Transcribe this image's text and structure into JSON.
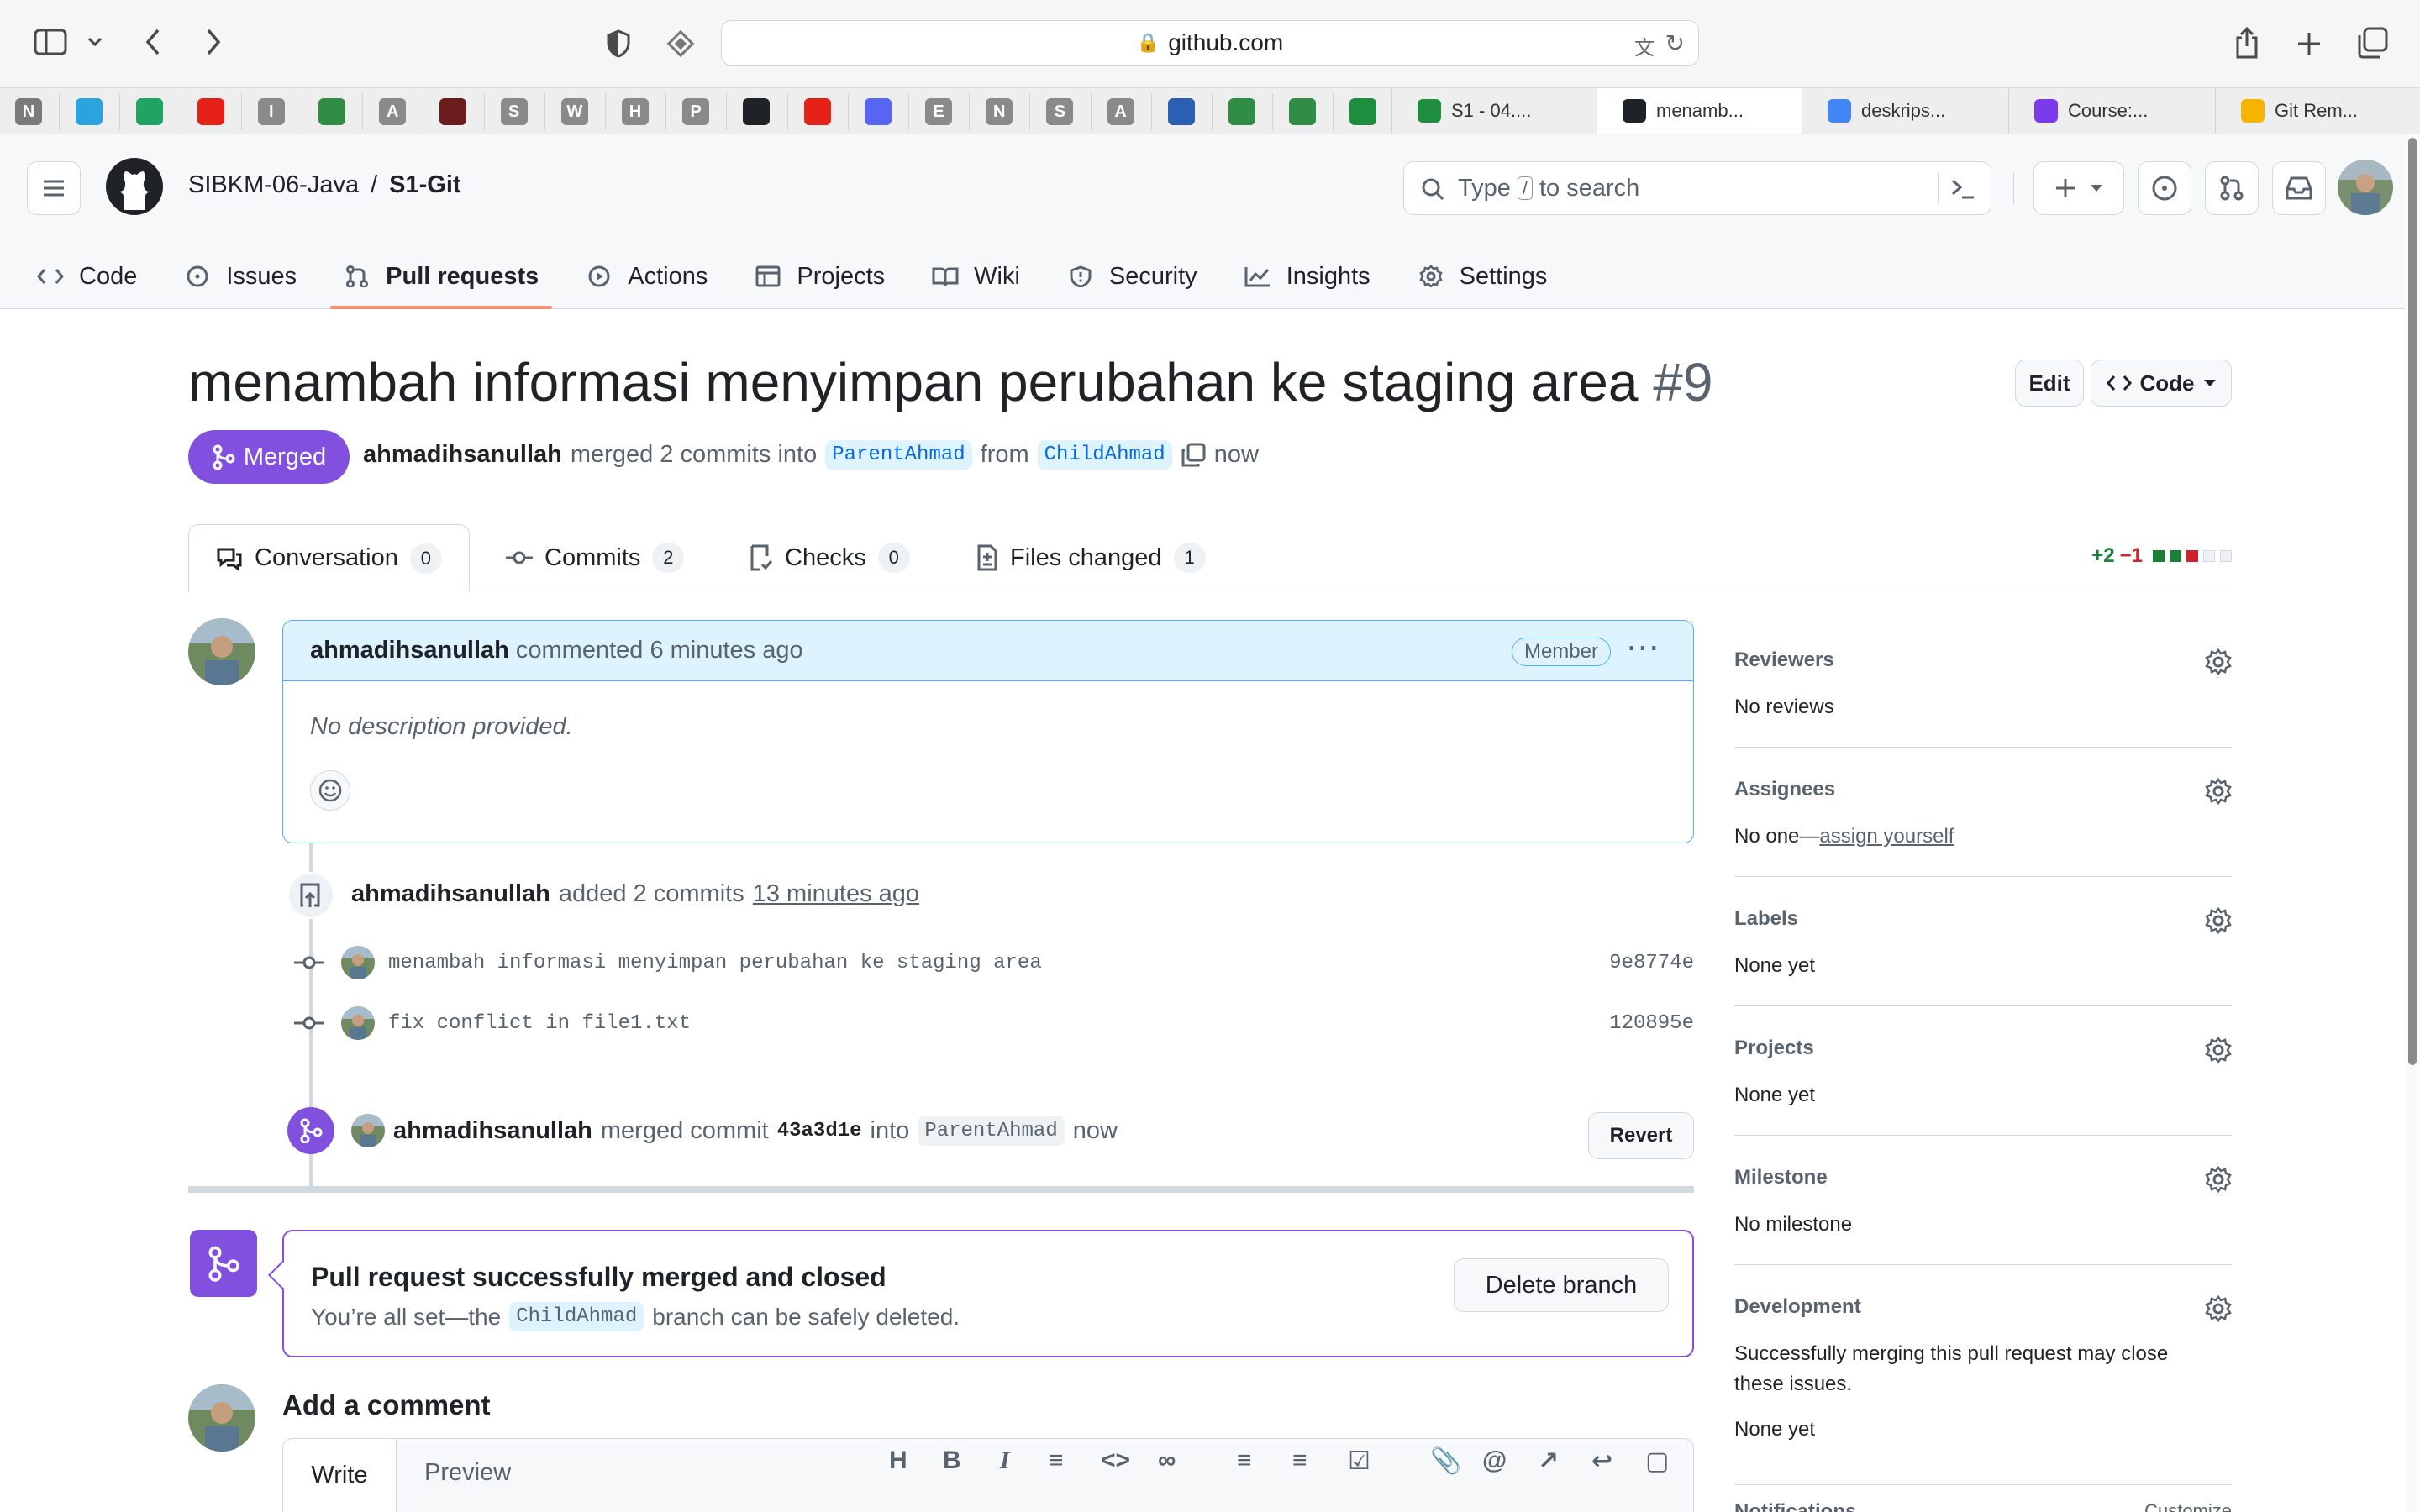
{
  "browser": {
    "address": "github.com",
    "pinned_tabs": [
      {
        "icon": "notion-icon",
        "letter": "N",
        "color": "#7a7a7a"
      },
      {
        "icon": "telegram-icon",
        "letter": "",
        "color": "#2aa3df"
      },
      {
        "icon": "google-drive-icon",
        "letter": "",
        "color": "#1fa463"
      },
      {
        "icon": "youtube-icon",
        "letter": "",
        "color": "#e62117"
      },
      {
        "icon": "site-i-icon",
        "letter": "I",
        "color": "#8a8a8a"
      },
      {
        "icon": "geeks-icon",
        "letter": "",
        "color": "#2f8d46"
      },
      {
        "icon": "site-a-icon",
        "letter": "A",
        "color": "#8a8a8a"
      },
      {
        "icon": "anime-icon",
        "letter": "",
        "color": "#6b1c1c"
      },
      {
        "icon": "site-s-icon",
        "letter": "S",
        "color": "#8a8a8a"
      },
      {
        "icon": "site-w-icon",
        "letter": "W",
        "color": "#8a8a8a"
      },
      {
        "icon": "site-h-icon",
        "letter": "H",
        "color": "#8a8a8a"
      },
      {
        "icon": "site-p-icon",
        "letter": "P",
        "color": "#8a8a8a"
      },
      {
        "icon": "github-icon",
        "letter": "",
        "color": "#1f2328"
      },
      {
        "icon": "youtube-icon",
        "letter": "",
        "color": "#e62117"
      },
      {
        "icon": "discord-icon",
        "letter": "",
        "color": "#5865f2"
      },
      {
        "icon": "site-e-icon",
        "letter": "E",
        "color": "#8a8a8a"
      },
      {
        "icon": "site-n-icon",
        "letter": "N",
        "color": "#8a8a8a"
      },
      {
        "icon": "site-s-icon",
        "letter": "S",
        "color": "#8a8a8a"
      },
      {
        "icon": "site-a-icon",
        "letter": "A",
        "color": "#8a8a8a"
      },
      {
        "icon": "kampus-icon",
        "letter": "",
        "color": "#2b5fb4"
      },
      {
        "icon": "geeks-icon",
        "letter": "",
        "color": "#2f8d46"
      },
      {
        "icon": "geeks-icon",
        "letter": "",
        "color": "#2f8d46"
      },
      {
        "icon": "classroom-icon",
        "letter": "",
        "color": "#1e8e3e"
      }
    ],
    "tabs": [
      {
        "label": "S1 - 04....",
        "icon": "classroom-icon",
        "color": "#1e8e3e"
      },
      {
        "label": "menamb...",
        "icon": "github-icon",
        "color": "#1f2328"
      },
      {
        "label": "deskrips...",
        "icon": "google-icon",
        "color": "#4285f4"
      },
      {
        "label": "Course:...",
        "icon": "course-icon",
        "color": "#7c3aed"
      },
      {
        "label": "Git Rem...",
        "icon": "slides-icon",
        "color": "#f4b400"
      }
    ]
  },
  "github": {
    "owner": "SIBKM-06-Java",
    "separator": "/",
    "repo": "S1-Git",
    "search_prefix": "Type",
    "search_key": "/",
    "search_suffix": "to search",
    "nav": [
      {
        "label": "Code",
        "icon": "code-icon"
      },
      {
        "label": "Issues",
        "icon": "issue-icon"
      },
      {
        "label": "Pull requests",
        "icon": "pull-request-icon"
      },
      {
        "label": "Actions",
        "icon": "play-icon"
      },
      {
        "label": "Projects",
        "icon": "table-icon"
      },
      {
        "label": "Wiki",
        "icon": "book-icon"
      },
      {
        "label": "Security",
        "icon": "shield-icon"
      },
      {
        "label": "Insights",
        "icon": "graph-icon"
      },
      {
        "label": "Settings",
        "icon": "gear-icon"
      }
    ]
  },
  "pr": {
    "title": "menambah informasi menyimpan perubahan ke staging area",
    "number": "#9",
    "edit_label": "Edit",
    "code_label": "Code",
    "state": "Merged",
    "author": "ahmadihsanullah",
    "merged_text": "merged 2 commits into",
    "base_branch": "ParentAhmad",
    "from_text": "from",
    "head_branch": "ChildAhmad",
    "time": "now",
    "tabs": [
      {
        "label": "Conversation",
        "count": "0",
        "icon": "comment-icon"
      },
      {
        "label": "Commits",
        "count": "2",
        "icon": "commit-icon"
      },
      {
        "label": "Checks",
        "count": "0",
        "icon": "checklist-icon"
      },
      {
        "label": "Files changed",
        "count": "1",
        "icon": "file-diff-icon"
      }
    ],
    "additions": "+2",
    "deletions": "−1"
  },
  "comment": {
    "author": "ahmadihsanullah",
    "action": "commented 6 minutes ago",
    "badge": "Member",
    "body": "No description provided."
  },
  "timeline": {
    "added": {
      "author": "ahmadihsanullah",
      "text": "added 2 commits",
      "time": "13 minutes ago"
    },
    "commits": [
      {
        "message": "menambah informasi menyimpan perubahan ke staging area",
        "sha": "9e8774e"
      },
      {
        "message": "fix conflict in file1.txt",
        "sha": "120895e"
      }
    ],
    "merged": {
      "author": "ahmadihsanullah",
      "text": "merged commit",
      "sha": "43a3d1e",
      "into": "into",
      "branch": "ParentAhmad",
      "time": "now",
      "revert_label": "Revert"
    }
  },
  "merge_box": {
    "title": "Pull request successfully merged and closed",
    "line_prefix": "You’re all set—the",
    "branch": "ChildAhmad",
    "line_suffix": "branch can be safely deleted.",
    "delete_label": "Delete branch"
  },
  "add_comment": {
    "title": "Add a comment",
    "write_tab": "Write",
    "preview_tab": "Preview"
  },
  "sidebar": {
    "reviewers": {
      "title": "Reviewers",
      "value": "No reviews"
    },
    "assignees": {
      "title": "Assignees",
      "prefix": "No one—",
      "link": "assign yourself"
    },
    "labels": {
      "title": "Labels",
      "value": "None yet"
    },
    "projects": {
      "title": "Projects",
      "value": "None yet"
    },
    "milestone": {
      "title": "Milestone",
      "value": "No milestone"
    },
    "development": {
      "title": "Development",
      "value": "Successfully merging this pull request may close these issues.",
      "value2": "None yet"
    },
    "notifications": {
      "title": "Notifications",
      "action": "Customize"
    }
  },
  "colors": {
    "merged_purple": "#8250df",
    "accent_blue": "#0969da",
    "addition_green": "#1a7f37",
    "deletion_red": "#cf222e",
    "tab_underline": "#fd8c73"
  }
}
